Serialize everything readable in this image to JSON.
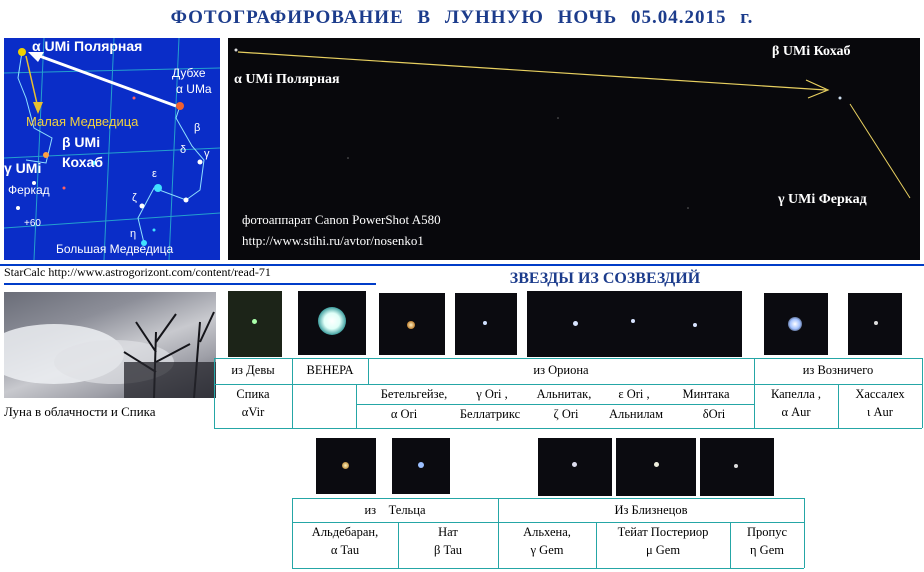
{
  "title": "ФОТОГРАФИРОВАНИЕ  В  ЛУННУЮ  НОЧЬ  05.04.2015 г.",
  "starmap": {
    "alpha_umi": "α UMi Полярная",
    "dubhe": "Дубхе",
    "alpha_uma": "α UMa",
    "little_dipper": "Малая Медведица",
    "beta_umi": "β UMi",
    "kochab": "Кохаб",
    "gamma_umi": "γ UMi",
    "ferkad": "Феркад",
    "beta": "β",
    "delta": "δ",
    "gamma": "γ",
    "epsilon": "ε",
    "zeta": "ζ",
    "eta": "η",
    "plus60": "+60",
    "big_dipper": "Большая Медведица"
  },
  "sky": {
    "alpha_umi": "α UMi Полярная",
    "beta_umi": "β UMi  Кохаб",
    "gamma_umi": "γ UMi Феркад",
    "camera": "фотоаппарат Canon PowerShot A580",
    "url": "http://www.stihi.ru/avtor/nosenko1"
  },
  "citation": "StarCalc  http://www.astrogorizont.com/content/read-71",
  "section_heading": "ЗВЕЗДЫ ИЗ СОЗВЕЗДИЙ",
  "moon_label": "Луна в облачности и Спика",
  "row1": {
    "virgo": "из Девы",
    "venus": "ВЕНЕРА",
    "orion": "из Ориона",
    "auriga": "из Возничего",
    "spica": "Спика",
    "alpha_vir": "αVir",
    "betelgeuse": "Бетельгейзе,",
    "gamma_ori": "γ Ori ,",
    "alnitak": "Альнитак,",
    "eps_ori": "ε Ori ,",
    "mintaka": "Минтака",
    "alpha_ori": "α Ori",
    "bellatrix": "Беллатрикс",
    "zeta_ori": "ζ Ori",
    "alnilam": "Альнилам",
    "delta_ori": "δOri",
    "capella": "Капелла ,",
    "alpha_aur": "α  Aur",
    "hassaleh": "Хассалех",
    "iota_aur": "ι  Aur"
  },
  "row2": {
    "taurus": "из    Тельца",
    "gemini": "Из Близнецов",
    "aldebaran": "Альдебаран,",
    "alpha_tau": "α Tau",
    "nath": "Нат",
    "beta_tau": "β  Tau",
    "alhena": "Альхена,",
    "gamma_gem": "γ Gem",
    "tejat": "Тейат Постериор",
    "mu_gem": "μ Gem",
    "propus": "Пропус",
    "eta_gem": "η Gem"
  }
}
